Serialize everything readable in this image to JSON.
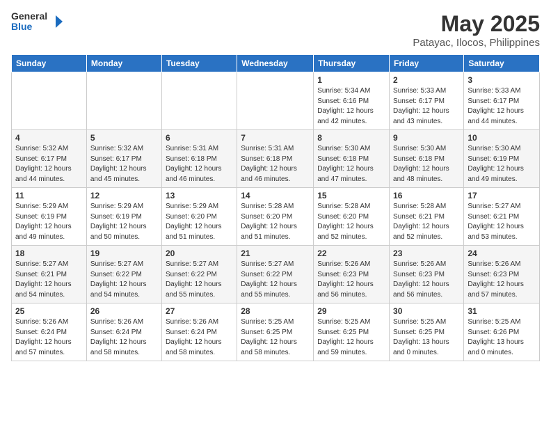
{
  "logo": {
    "line1": "General",
    "line2": "Blue"
  },
  "title": "May 2025",
  "subtitle": "Patayac, Ilocos, Philippines",
  "weekdays": [
    "Sunday",
    "Monday",
    "Tuesday",
    "Wednesday",
    "Thursday",
    "Friday",
    "Saturday"
  ],
  "weeks": [
    [
      {
        "day": "",
        "info": ""
      },
      {
        "day": "",
        "info": ""
      },
      {
        "day": "",
        "info": ""
      },
      {
        "day": "",
        "info": ""
      },
      {
        "day": "1",
        "info": "Sunrise: 5:34 AM\nSunset: 6:16 PM\nDaylight: 12 hours\nand 42 minutes."
      },
      {
        "day": "2",
        "info": "Sunrise: 5:33 AM\nSunset: 6:17 PM\nDaylight: 12 hours\nand 43 minutes."
      },
      {
        "day": "3",
        "info": "Sunrise: 5:33 AM\nSunset: 6:17 PM\nDaylight: 12 hours\nand 44 minutes."
      }
    ],
    [
      {
        "day": "4",
        "info": "Sunrise: 5:32 AM\nSunset: 6:17 PM\nDaylight: 12 hours\nand 44 minutes."
      },
      {
        "day": "5",
        "info": "Sunrise: 5:32 AM\nSunset: 6:17 PM\nDaylight: 12 hours\nand 45 minutes."
      },
      {
        "day": "6",
        "info": "Sunrise: 5:31 AM\nSunset: 6:18 PM\nDaylight: 12 hours\nand 46 minutes."
      },
      {
        "day": "7",
        "info": "Sunrise: 5:31 AM\nSunset: 6:18 PM\nDaylight: 12 hours\nand 46 minutes."
      },
      {
        "day": "8",
        "info": "Sunrise: 5:30 AM\nSunset: 6:18 PM\nDaylight: 12 hours\nand 47 minutes."
      },
      {
        "day": "9",
        "info": "Sunrise: 5:30 AM\nSunset: 6:18 PM\nDaylight: 12 hours\nand 48 minutes."
      },
      {
        "day": "10",
        "info": "Sunrise: 5:30 AM\nSunset: 6:19 PM\nDaylight: 12 hours\nand 49 minutes."
      }
    ],
    [
      {
        "day": "11",
        "info": "Sunrise: 5:29 AM\nSunset: 6:19 PM\nDaylight: 12 hours\nand 49 minutes."
      },
      {
        "day": "12",
        "info": "Sunrise: 5:29 AM\nSunset: 6:19 PM\nDaylight: 12 hours\nand 50 minutes."
      },
      {
        "day": "13",
        "info": "Sunrise: 5:29 AM\nSunset: 6:20 PM\nDaylight: 12 hours\nand 51 minutes."
      },
      {
        "day": "14",
        "info": "Sunrise: 5:28 AM\nSunset: 6:20 PM\nDaylight: 12 hours\nand 51 minutes."
      },
      {
        "day": "15",
        "info": "Sunrise: 5:28 AM\nSunset: 6:20 PM\nDaylight: 12 hours\nand 52 minutes."
      },
      {
        "day": "16",
        "info": "Sunrise: 5:28 AM\nSunset: 6:21 PM\nDaylight: 12 hours\nand 52 minutes."
      },
      {
        "day": "17",
        "info": "Sunrise: 5:27 AM\nSunset: 6:21 PM\nDaylight: 12 hours\nand 53 minutes."
      }
    ],
    [
      {
        "day": "18",
        "info": "Sunrise: 5:27 AM\nSunset: 6:21 PM\nDaylight: 12 hours\nand 54 minutes."
      },
      {
        "day": "19",
        "info": "Sunrise: 5:27 AM\nSunset: 6:22 PM\nDaylight: 12 hours\nand 54 minutes."
      },
      {
        "day": "20",
        "info": "Sunrise: 5:27 AM\nSunset: 6:22 PM\nDaylight: 12 hours\nand 55 minutes."
      },
      {
        "day": "21",
        "info": "Sunrise: 5:27 AM\nSunset: 6:22 PM\nDaylight: 12 hours\nand 55 minutes."
      },
      {
        "day": "22",
        "info": "Sunrise: 5:26 AM\nSunset: 6:23 PM\nDaylight: 12 hours\nand 56 minutes."
      },
      {
        "day": "23",
        "info": "Sunrise: 5:26 AM\nSunset: 6:23 PM\nDaylight: 12 hours\nand 56 minutes."
      },
      {
        "day": "24",
        "info": "Sunrise: 5:26 AM\nSunset: 6:23 PM\nDaylight: 12 hours\nand 57 minutes."
      }
    ],
    [
      {
        "day": "25",
        "info": "Sunrise: 5:26 AM\nSunset: 6:24 PM\nDaylight: 12 hours\nand 57 minutes."
      },
      {
        "day": "26",
        "info": "Sunrise: 5:26 AM\nSunset: 6:24 PM\nDaylight: 12 hours\nand 58 minutes."
      },
      {
        "day": "27",
        "info": "Sunrise: 5:26 AM\nSunset: 6:24 PM\nDaylight: 12 hours\nand 58 minutes."
      },
      {
        "day": "28",
        "info": "Sunrise: 5:25 AM\nSunset: 6:25 PM\nDaylight: 12 hours\nand 58 minutes."
      },
      {
        "day": "29",
        "info": "Sunrise: 5:25 AM\nSunset: 6:25 PM\nDaylight: 12 hours\nand 59 minutes."
      },
      {
        "day": "30",
        "info": "Sunrise: 5:25 AM\nSunset: 6:25 PM\nDaylight: 13 hours\nand 0 minutes."
      },
      {
        "day": "31",
        "info": "Sunrise: 5:25 AM\nSunset: 6:26 PM\nDaylight: 13 hours\nand 0 minutes."
      }
    ]
  ]
}
